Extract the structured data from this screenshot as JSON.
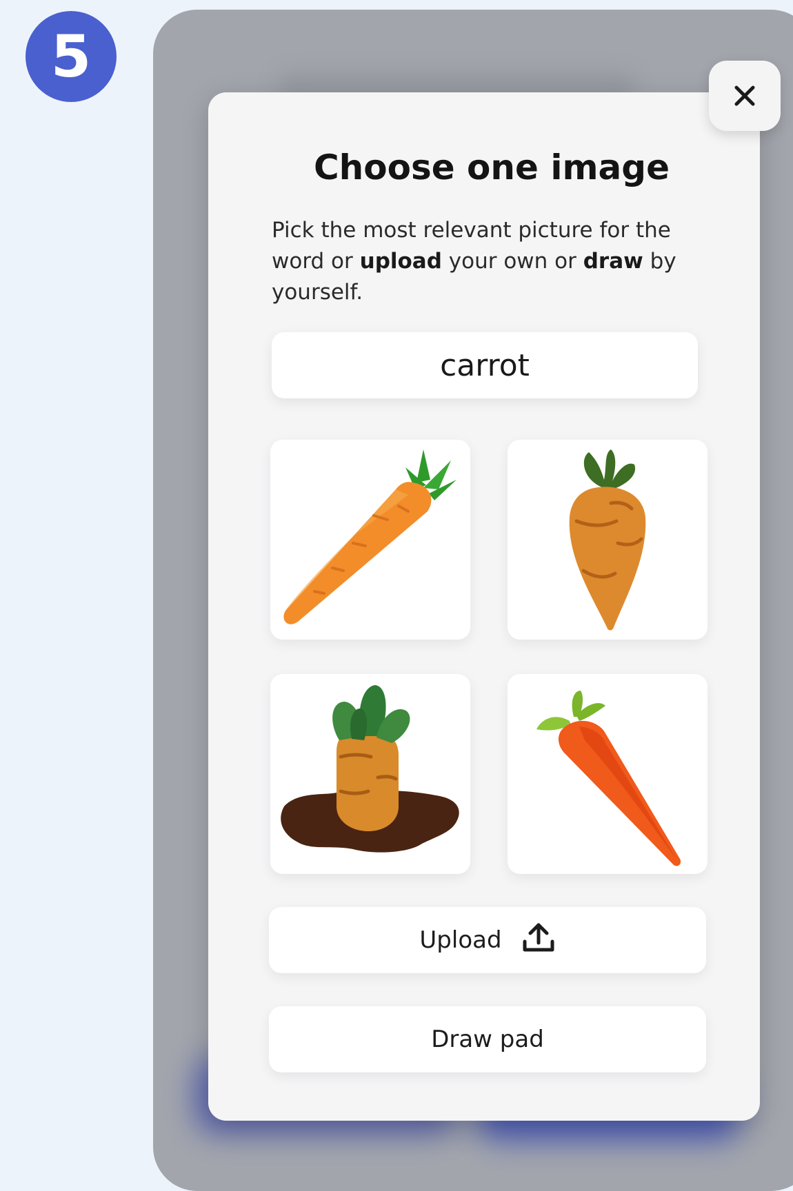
{
  "step": {
    "number": "5",
    "badge_color": "#4a60cf"
  },
  "modal": {
    "title": "Choose one image",
    "description": {
      "part1": "Pick the most relevant picture for the word or ",
      "bold1": "upload",
      "part2": " your own or ",
      "bold2": "draw",
      "part3": " by yourself."
    },
    "word": "carrot",
    "close_icon": "close-icon",
    "images": [
      {
        "name": "carrot-diagonal-image"
      },
      {
        "name": "carrot-upright-image"
      },
      {
        "name": "carrot-in-soil-image"
      },
      {
        "name": "carrot-red-diagonal-image"
      }
    ],
    "upload_label": "Upload",
    "upload_icon": "upload-icon",
    "draw_label": "Draw pad"
  },
  "colors": {
    "background": "#edf3fb",
    "backdrop": "#a2a5ac",
    "modal": "#f5f5f6",
    "accent": "#4a60cf"
  }
}
